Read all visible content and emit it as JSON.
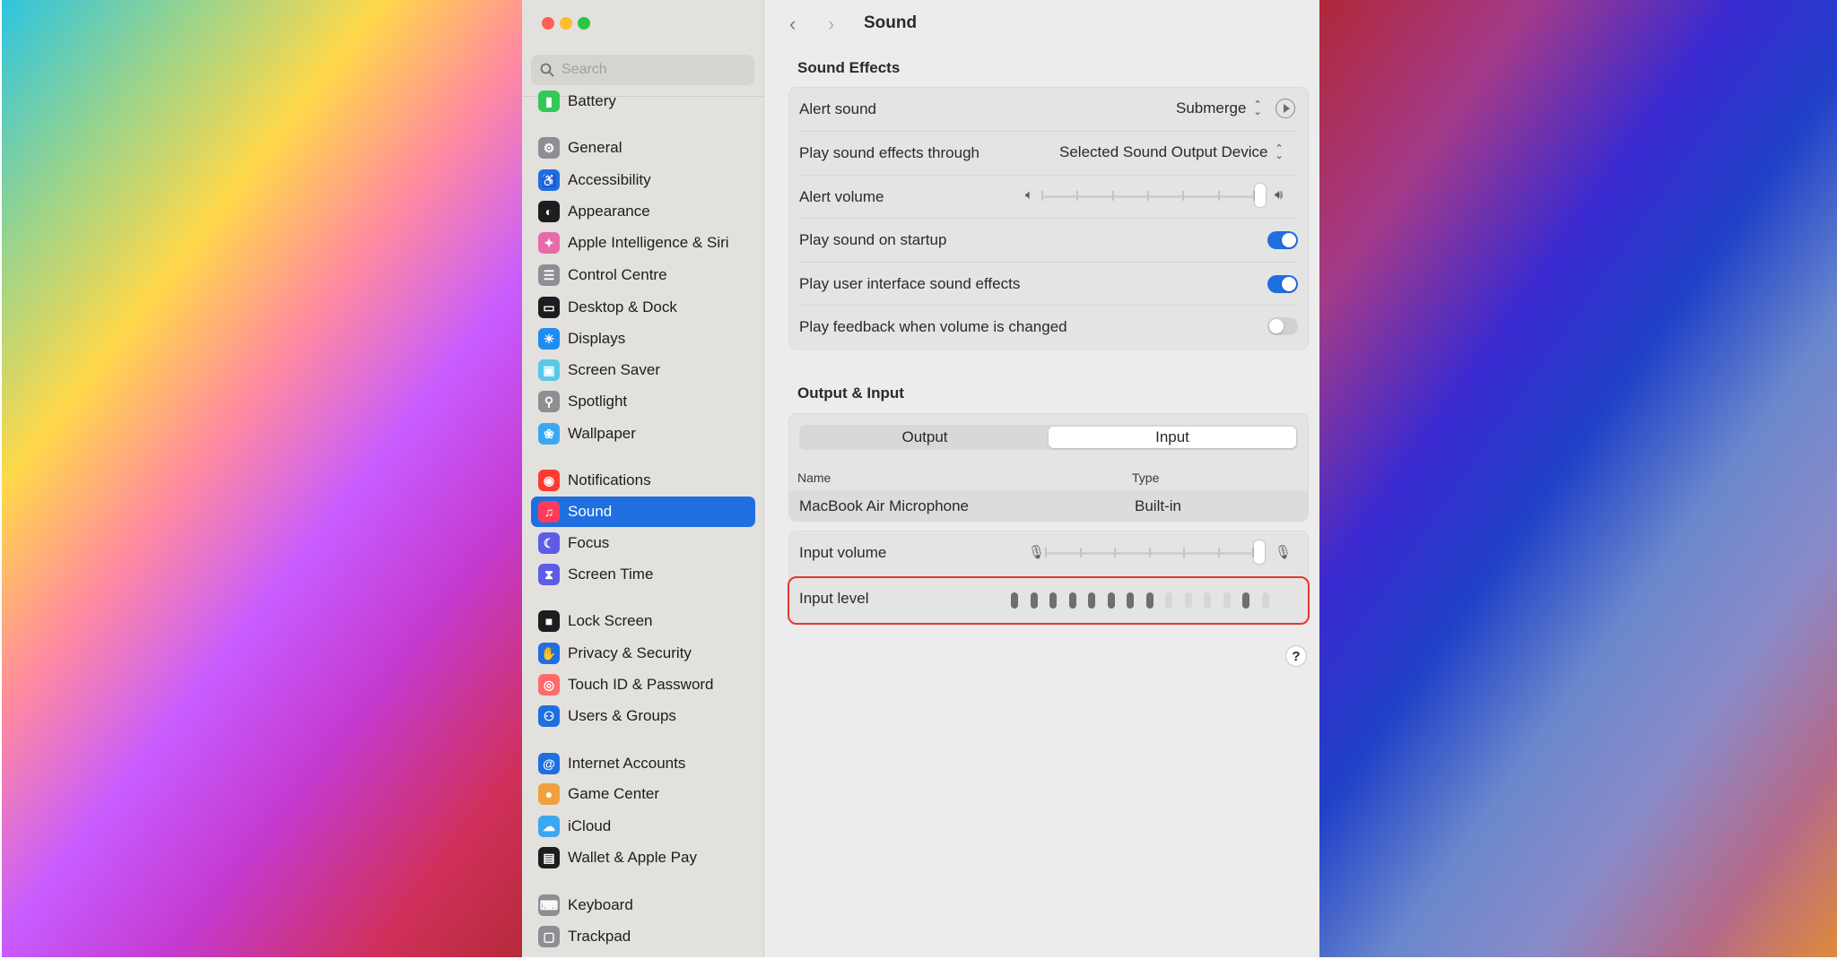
{
  "window": {
    "title": "Sound"
  },
  "search": {
    "placeholder": "Search"
  },
  "sidebar": {
    "items": [
      {
        "label": "Battery",
        "icon": "battery-icon",
        "color": "#34c759"
      },
      {
        "label": "General",
        "icon": "gear-icon",
        "color": "#8e8e93"
      },
      {
        "label": "Accessibility",
        "icon": "accessibility-icon",
        "color": "#1f6fe0"
      },
      {
        "label": "Appearance",
        "icon": "appearance-icon",
        "color": "#1d1d1f"
      },
      {
        "label": "Apple Intelligence & Siri",
        "icon": "siri-icon",
        "color": "#e86aa8"
      },
      {
        "label": "Control Centre",
        "icon": "control-centre-icon",
        "color": "#8e8e93"
      },
      {
        "label": "Desktop & Dock",
        "icon": "dock-icon",
        "color": "#1d1d1f"
      },
      {
        "label": "Displays",
        "icon": "displays-icon",
        "color": "#1f8cf0"
      },
      {
        "label": "Screen Saver",
        "icon": "screen-saver-icon",
        "color": "#5ac8e8"
      },
      {
        "label": "Spotlight",
        "icon": "spotlight-icon",
        "color": "#8e8e93"
      },
      {
        "label": "Wallpaper",
        "icon": "wallpaper-icon",
        "color": "#3aa8f0"
      },
      {
        "label": "Notifications",
        "icon": "notifications-icon",
        "color": "#ff3b30"
      },
      {
        "label": "Sound",
        "icon": "sound-icon",
        "color": "#ff3b5c"
      },
      {
        "label": "Focus",
        "icon": "focus-icon",
        "color": "#5e5ce6"
      },
      {
        "label": "Screen Time",
        "icon": "screen-time-icon",
        "color": "#5e5ce6"
      },
      {
        "label": "Lock Screen",
        "icon": "lock-icon",
        "color": "#1d1d1f"
      },
      {
        "label": "Privacy & Security",
        "icon": "privacy-hand-icon",
        "color": "#1f6fe0"
      },
      {
        "label": "Touch ID & Password",
        "icon": "fingerprint-icon",
        "color": "#ff6b6b"
      },
      {
        "label": "Users & Groups",
        "icon": "users-icon",
        "color": "#1f6fe0"
      },
      {
        "label": "Internet Accounts",
        "icon": "at-icon",
        "color": "#1f6fe0"
      },
      {
        "label": "Game Center",
        "icon": "game-center-icon",
        "color": "#f0a040"
      },
      {
        "label": "iCloud",
        "icon": "cloud-icon",
        "color": "#3aa8f0"
      },
      {
        "label": "Wallet & Apple Pay",
        "icon": "wallet-icon",
        "color": "#1d1d1f"
      },
      {
        "label": "Keyboard",
        "icon": "keyboard-icon",
        "color": "#8e8e93"
      },
      {
        "label": "Trackpad",
        "icon": "trackpad-icon",
        "color": "#8e8e93"
      }
    ],
    "selected": "Sound"
  },
  "sound_effects": {
    "heading": "Sound Effects",
    "alert_sound_label": "Alert sound",
    "alert_sound_value": "Submerge",
    "play_through_label": "Play sound effects through",
    "play_through_value": "Selected Sound Output Device",
    "alert_volume_label": "Alert volume",
    "alert_volume_level": 1.0,
    "startup_label": "Play sound on startup",
    "startup_on": true,
    "ui_effects_label": "Play user interface sound effects",
    "ui_effects_on": true,
    "feedback_label": "Play feedback when volume is changed",
    "feedback_on": false
  },
  "output_input": {
    "heading": "Output & Input",
    "tabs": [
      "Output",
      "Input"
    ],
    "selected_tab": "Input",
    "columns": [
      "Name",
      "Type"
    ],
    "devices": [
      {
        "name": "MacBook Air Microphone",
        "type": "Built-in"
      }
    ],
    "input_volume_label": "Input volume",
    "input_volume_level": 1.0,
    "input_level_label": "Input level",
    "input_level_bars": [
      1,
      1,
      1,
      1,
      1,
      1,
      1,
      1,
      0,
      0,
      0,
      0,
      1,
      0
    ]
  },
  "help": {
    "label": "?"
  },
  "colors": {
    "accent": "#1f6fe0",
    "highlight": "#e4392f"
  }
}
